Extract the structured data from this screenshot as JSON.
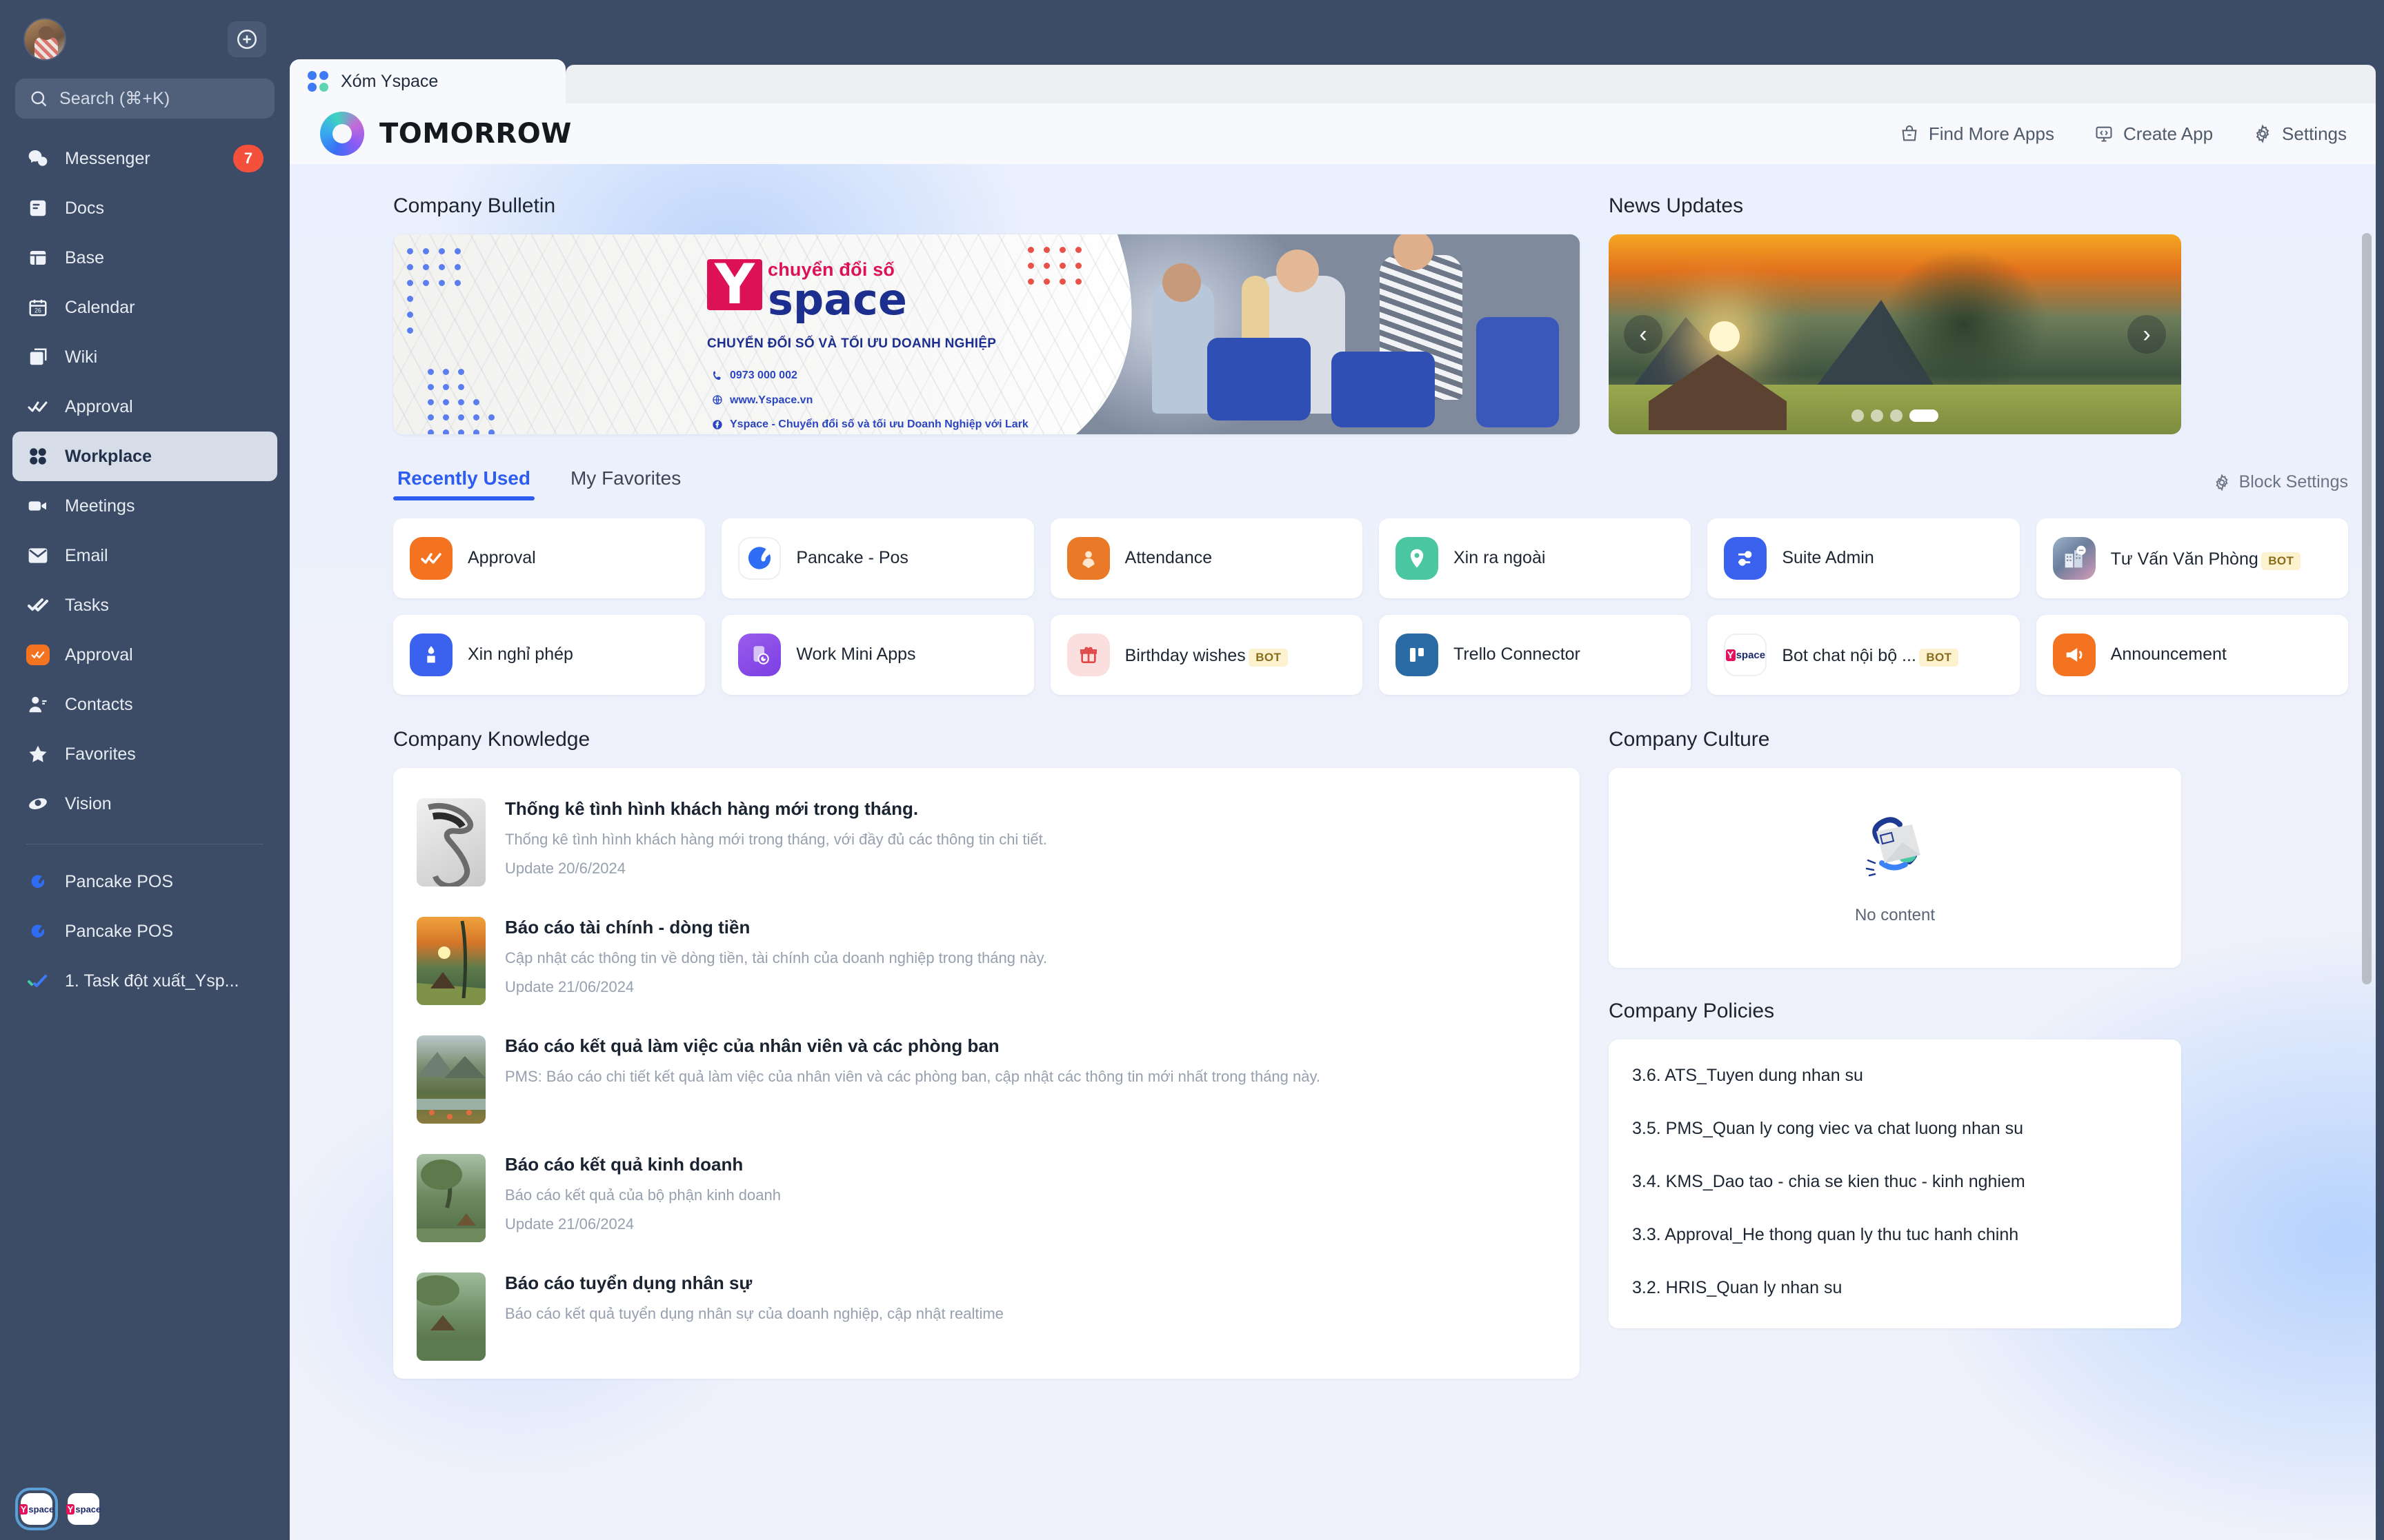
{
  "sidebar": {
    "search_placeholder": "Search (⌘+K)",
    "nav": [
      {
        "label": "Messenger",
        "icon": "messenger-icon",
        "badge": "7"
      },
      {
        "label": "Docs",
        "icon": "docs-icon",
        "badge": ""
      },
      {
        "label": "Base",
        "icon": "base-icon",
        "badge": ""
      },
      {
        "label": "Calendar",
        "icon": "calendar-icon",
        "badge": ""
      },
      {
        "label": "Wiki",
        "icon": "wiki-icon",
        "badge": ""
      },
      {
        "label": "Approval",
        "icon": "approval-icon",
        "badge": ""
      },
      {
        "label": "Workplace",
        "icon": "workplace-icon",
        "badge": ""
      },
      {
        "label": "Meetings",
        "icon": "meetings-icon",
        "badge": ""
      },
      {
        "label": "Email",
        "icon": "email-icon",
        "badge": ""
      },
      {
        "label": "Tasks",
        "icon": "tasks-icon",
        "badge": ""
      },
      {
        "label": "Approval",
        "icon": "approval-app-icon",
        "badge": ""
      },
      {
        "label": "Contacts",
        "icon": "contacts-icon",
        "badge": ""
      },
      {
        "label": "Favorites",
        "icon": "star-icon",
        "badge": ""
      },
      {
        "label": "Vision",
        "icon": "vision-icon",
        "badge": ""
      }
    ],
    "pinned": [
      {
        "label": "Pancake POS",
        "icon": "pancake-icon"
      },
      {
        "label": "Pancake POS",
        "icon": "pancake-icon"
      },
      {
        "label": "1. Task đột xuất_Ysp...",
        "icon": "tasks-icon"
      }
    ]
  },
  "window": {
    "tab_label": "Xóm Yspace",
    "brand_name": "TOMORROW",
    "top_actions": [
      {
        "label": "Find More Apps",
        "icon": "bag-icon"
      },
      {
        "label": "Create App",
        "icon": "code-monitor-icon"
      },
      {
        "label": "Settings",
        "icon": "gear-icon"
      }
    ]
  },
  "bulletin": {
    "title": "Company Bulletin",
    "logo_mark": "Y",
    "tagline_small": "chuyển đổi số",
    "logo_word": "space",
    "subtitle": "CHUYỂN ĐỔI SỐ VÀ TỐI ƯU DOANH NGHIỆP",
    "phone": "0973 000 002",
    "website": "www.Yspace.vn",
    "facebook": "Yspace - Chuyển đổi số và tối ưu Doanh Nghiệp với Lark"
  },
  "news": {
    "title": "News Updates",
    "prev": "‹",
    "next": "›",
    "dots_total": 4,
    "dots_active": 4
  },
  "apps_section": {
    "tabs": [
      {
        "label": "Recently Used",
        "active": true
      },
      {
        "label": "My Favorites",
        "active": false
      }
    ],
    "block_settings": "Block Settings",
    "items": [
      {
        "name": "Approval",
        "badge": "",
        "icon": "approval-app-icon"
      },
      {
        "name": "Pancake - Pos",
        "badge": "",
        "icon": "pancake-icon"
      },
      {
        "name": "Attendance",
        "badge": "",
        "icon": "attendance-icon"
      },
      {
        "name": "Xin ra ngoài",
        "badge": "",
        "icon": "location-pin-icon"
      },
      {
        "name": "Suite Admin",
        "badge": "",
        "icon": "suite-admin-icon"
      },
      {
        "name": "Tư Vấn Văn Phòng",
        "badge": "BOT",
        "icon": "office-bot-icon"
      },
      {
        "name": "Xin nghỉ phép",
        "badge": "",
        "icon": "leave-request-icon"
      },
      {
        "name": "Work Mini Apps",
        "badge": "",
        "icon": "mini-apps-icon"
      },
      {
        "name": "Birthday wishes",
        "badge": "BOT",
        "icon": "gift-icon"
      },
      {
        "name": "Trello Connector",
        "badge": "",
        "icon": "trello-icon"
      },
      {
        "name": "Bot chat nội bộ ...",
        "badge": "BOT",
        "icon": "yspace-icon"
      },
      {
        "name": "Announcement",
        "badge": "",
        "icon": "megaphone-icon"
      }
    ]
  },
  "knowledge": {
    "title": "Company Knowledge",
    "items": [
      {
        "title": "Thống kê tình hình khách hàng mới trong tháng.",
        "desc": "Thống kê tình hình khách hàng mới trong tháng, với đầy đủ các thông tin chi tiết.",
        "date": "Update 20/6/2024",
        "thumb": "robot"
      },
      {
        "title": "Báo cáo tài chính - dòng tiền",
        "desc": "Cập nhật các thông tin về dòng tiền, tài chính của doanh nghiệp trong tháng này.",
        "date": "Update 21/06/2024",
        "thumb": "sunset"
      },
      {
        "title": "Báo cáo kết quả làm việc của nhân viên và các phòng ban",
        "desc": "PMS: Báo cáo chi tiết kết quả làm việc của nhân viên và các phòng ban, cập nhật các thông tin mới nhất trong tháng này.",
        "date": "",
        "thumb": "valley"
      },
      {
        "title": "Báo cáo kết quả kinh doanh",
        "desc": "Báo cáo kết quả của bộ phận kinh doanh",
        "date": "Update 21/06/2024",
        "thumb": "forest"
      },
      {
        "title": "Báo cáo tuyển dụng nhân sự",
        "desc": "Báo cáo kết quả tuyển dụng nhân sự của doanh nghiệp, cập nhật realtime",
        "date": "",
        "thumb": "rays"
      }
    ]
  },
  "culture": {
    "title": "Company Culture",
    "empty_text": "No content"
  },
  "policies": {
    "title": "Company Policies",
    "items": [
      "3.6. ATS_Tuyen dung nhan su",
      "3.5. PMS_Quan ly cong viec va chat luong nhan su",
      "3.4. KMS_Dao tao - chia se kien thuc - kinh nghiem",
      "3.3. Approval_He thong quan ly thu tuc hanh chinh",
      "3.2. HRIS_Quan ly nhan su"
    ]
  },
  "colors": {
    "sidebar_bg": "#3d4c66",
    "accent": "#2d5cf0",
    "badge_red": "#f4503c",
    "bot_badge_bg": "#fdf2d0"
  }
}
